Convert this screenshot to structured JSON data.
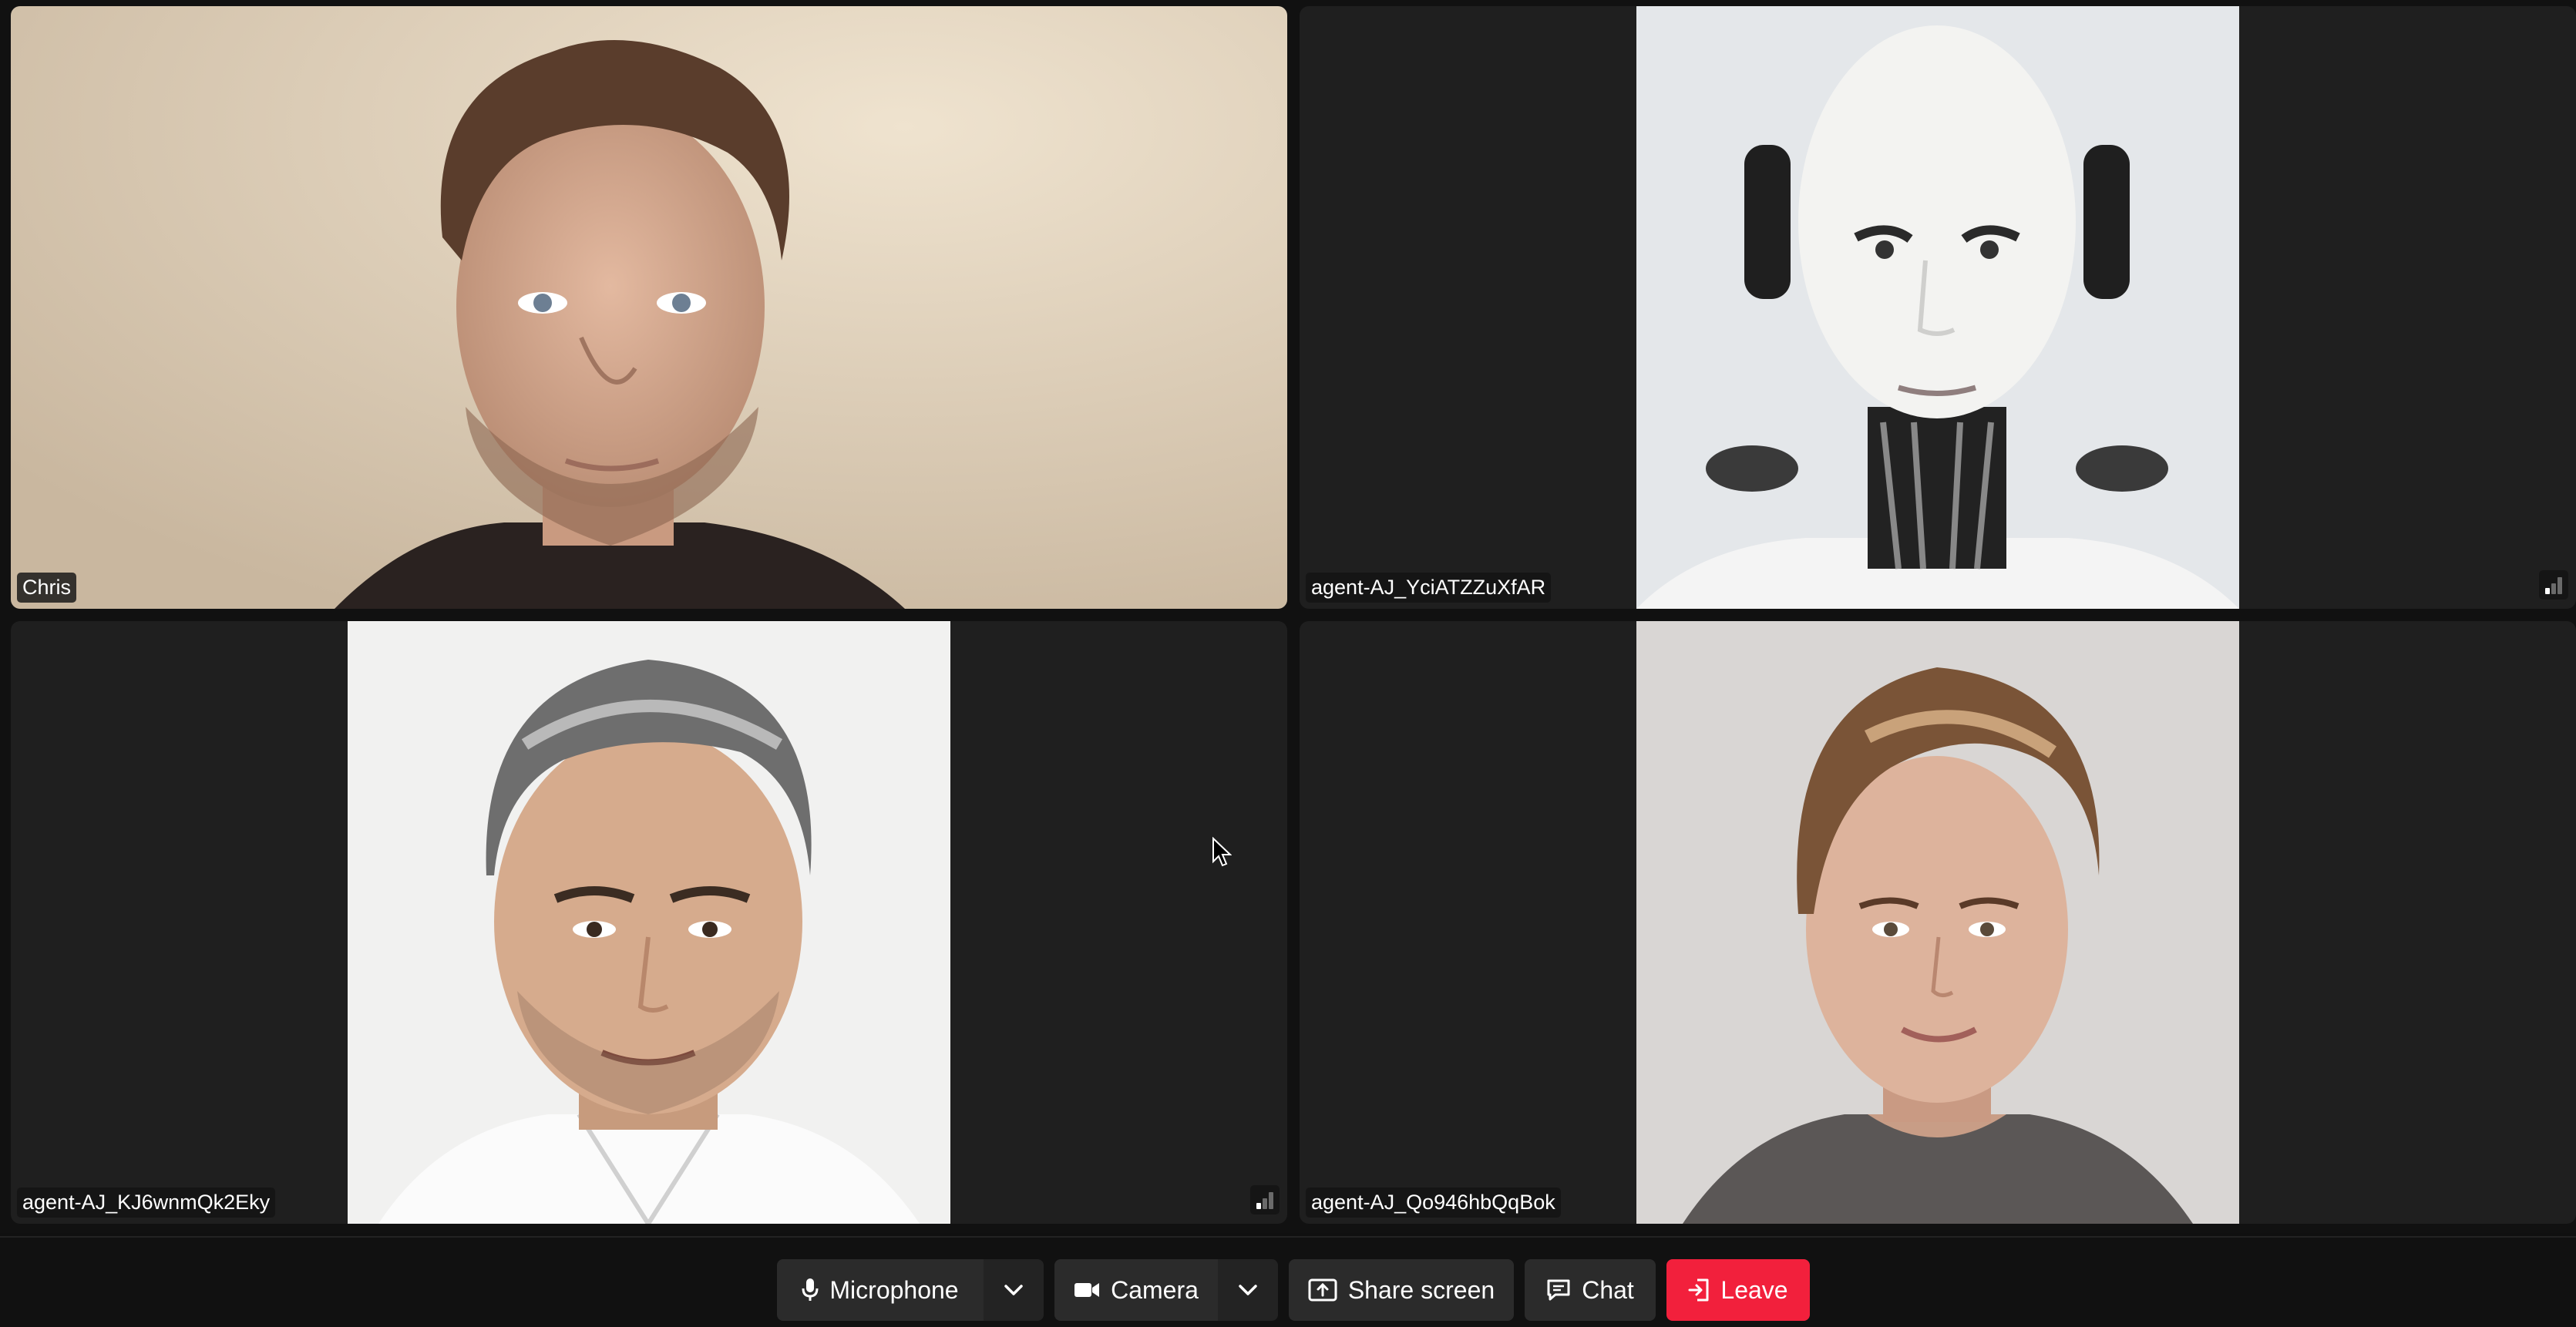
{
  "participants": [
    {
      "name": "Chris"
    },
    {
      "name": "agent-AJ_YciATZZuXfAR"
    },
    {
      "name": "agent-AJ_KJ6wnmQk2Eky"
    },
    {
      "name": "agent-AJ_Qo946hbQqBok"
    }
  ],
  "controls": {
    "microphone_label": "Microphone",
    "camera_label": "Camera",
    "share_label": "Share screen",
    "chat_label": "Chat",
    "leave_label": "Leave"
  },
  "icons": {
    "microphone": "microphone-icon",
    "camera": "camera-icon",
    "share": "share-screen-icon",
    "chat": "chat-icon",
    "leave": "leave-icon",
    "chevron": "chevron-down-icon",
    "signal": "signal-strength-icon"
  },
  "colors": {
    "leave": "#f2203c",
    "tile_bg": "#1f1f1f",
    "control_bg": "#2b2b2b"
  }
}
